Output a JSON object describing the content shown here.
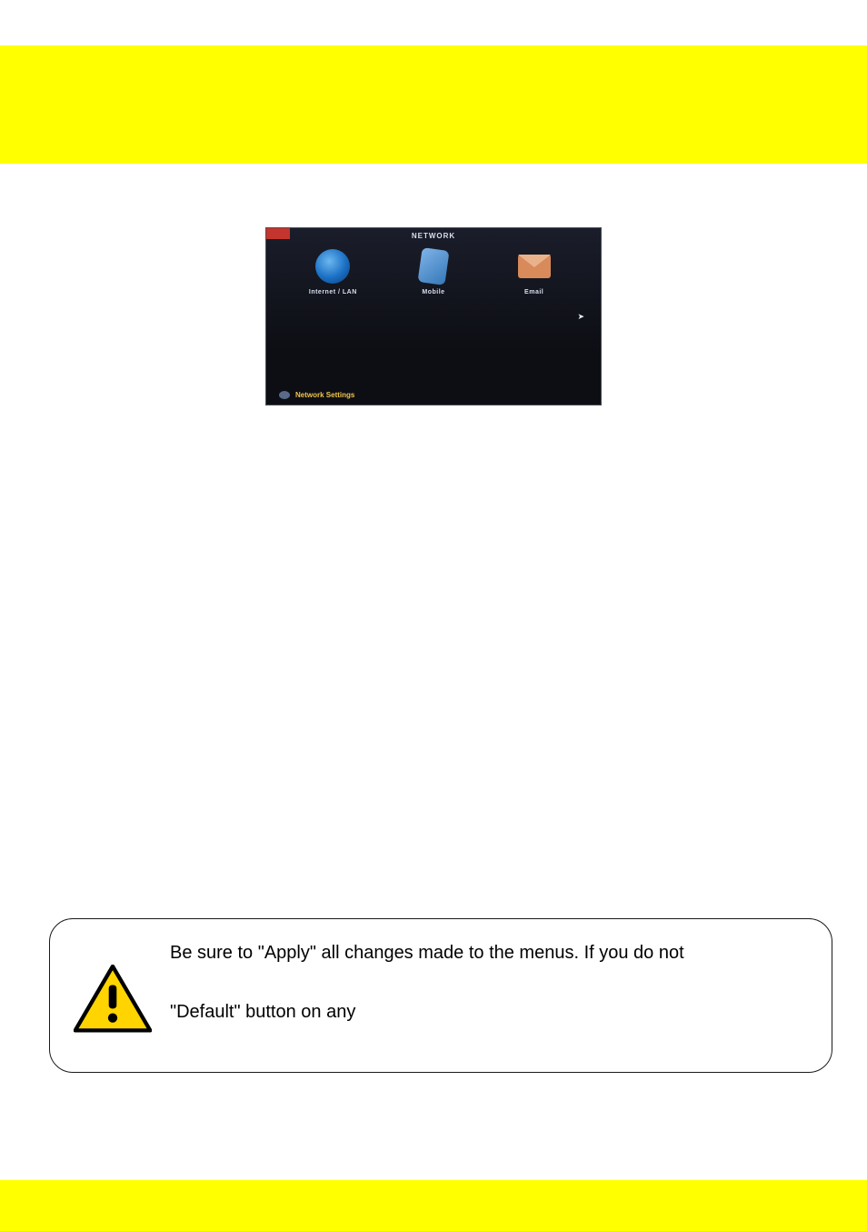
{
  "screenshot": {
    "title": "NETWORK",
    "items": [
      {
        "label": "Internet  /  LAN"
      },
      {
        "label": "Mobile"
      },
      {
        "label": "Email"
      }
    ],
    "footer": "Network  Settings"
  },
  "note": {
    "line1": "Be sure to \"Apply\" all changes made to the menus. If you do not",
    "line2": "\"Default\" button on any"
  }
}
